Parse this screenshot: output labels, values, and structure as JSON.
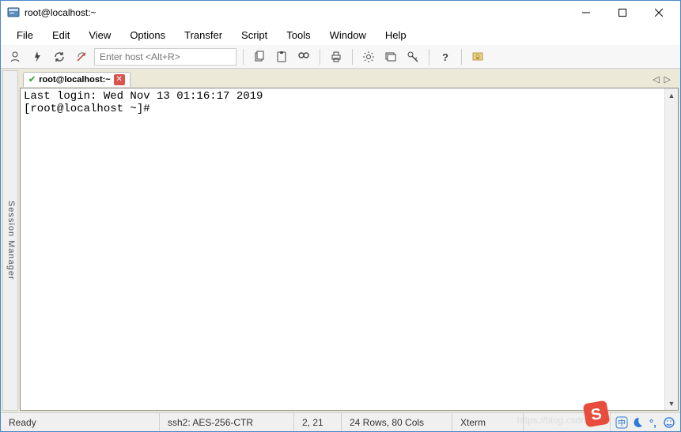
{
  "titlebar": {
    "title": "root@localhost:~"
  },
  "menubar": {
    "items": [
      "File",
      "Edit",
      "View",
      "Options",
      "Transfer",
      "Script",
      "Tools",
      "Window",
      "Help"
    ]
  },
  "toolbar": {
    "host_placeholder": "Enter host <Alt+R>"
  },
  "session_manager_label": "Session Manager",
  "tab": {
    "title": "root@localhost:~"
  },
  "terminal": {
    "lines": [
      "Last login: Wed Nov 13 01:16:17 2019",
      "[root@localhost ~]#"
    ]
  },
  "statusbar": {
    "state": "Ready",
    "protocol": "ssh2: AES-256-CTR",
    "cursor": "2,  21",
    "size": "24 Rows, 80 Cols",
    "term": "Xterm"
  }
}
